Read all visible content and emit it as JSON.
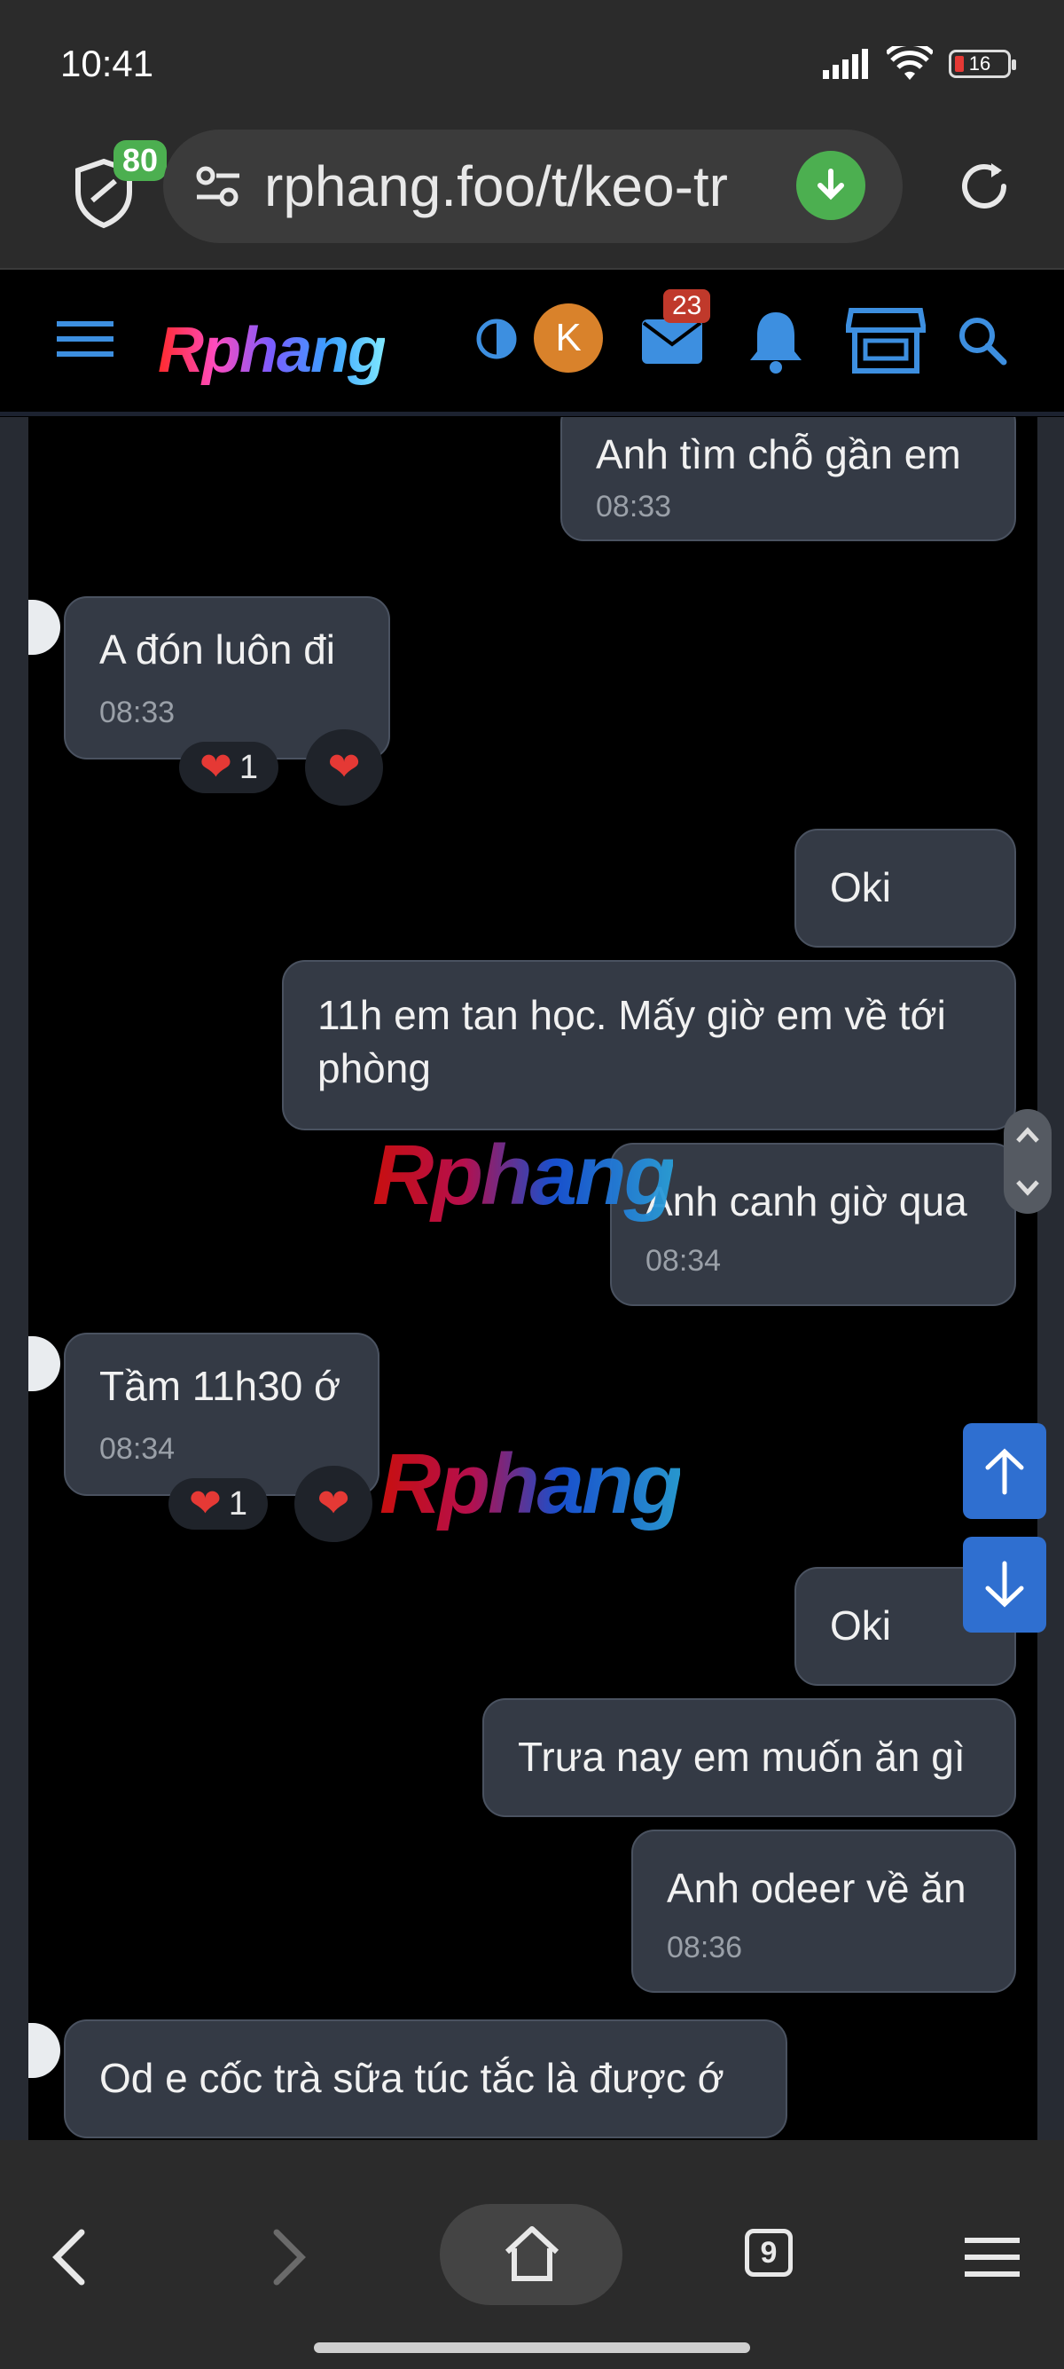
{
  "status": {
    "time": "10:41",
    "battery": "16"
  },
  "browser": {
    "shield_count": "80",
    "url": "rphang.foo/t/keo-tr",
    "tabs_count": "9"
  },
  "forum": {
    "logo": "Rphang",
    "avatar_letter": "K",
    "inbox_count": "23",
    "watermark": "Rphang"
  },
  "messages": [
    {
      "side": "right",
      "text": "Anh tìm chỗ gần em",
      "time": "08:33"
    },
    {
      "side": "left",
      "text": "A đón luôn đi",
      "time": "08:33",
      "reaction_count": "1"
    },
    {
      "side": "right",
      "text": "Oki"
    },
    {
      "side": "right",
      "text": "11h em tan học. Mấy giờ em về tới phòng"
    },
    {
      "side": "right",
      "text": "Anh canh giờ qua",
      "time": "08:34"
    },
    {
      "side": "left",
      "text": "Tầm 11h30 ớ",
      "time": "08:34",
      "reaction_count": "1"
    },
    {
      "side": "right",
      "text": "Oki"
    },
    {
      "side": "right",
      "text": "Trưa nay em muốn ăn gì"
    },
    {
      "side": "right",
      "text": "Anh odeer về ăn",
      "time": "08:36"
    },
    {
      "side": "left",
      "text": "Od e cốc trà sữa túc tắc là được ớ"
    }
  ],
  "colors": {
    "bubble": "#343a45",
    "accent": "#2f6fd0",
    "badge_green": "#4caf50",
    "badge_red": "#c0392b"
  }
}
